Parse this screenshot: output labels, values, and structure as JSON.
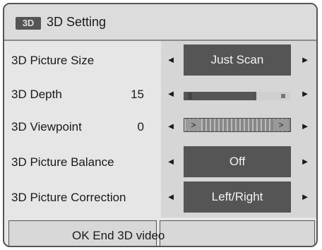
{
  "title": {
    "icon": "3d-icon",
    "icon_text": "3D",
    "text": "3D Setting"
  },
  "rows": [
    {
      "label": "3D Picture Size",
      "value": "Just Scan"
    },
    {
      "label": "3D Depth",
      "number": "15",
      "level": 0.68
    },
    {
      "label": "3D Viewpoint",
      "number": "0",
      "level": 0.5
    },
    {
      "label": "3D Picture Balance",
      "value": "Off"
    },
    {
      "label": "3D Picture Correction",
      "value": "Left/Right"
    }
  ],
  "arrows": {
    "left": "◄",
    "right": "►"
  },
  "footer": {
    "ok_label": "OK End 3D video"
  }
}
